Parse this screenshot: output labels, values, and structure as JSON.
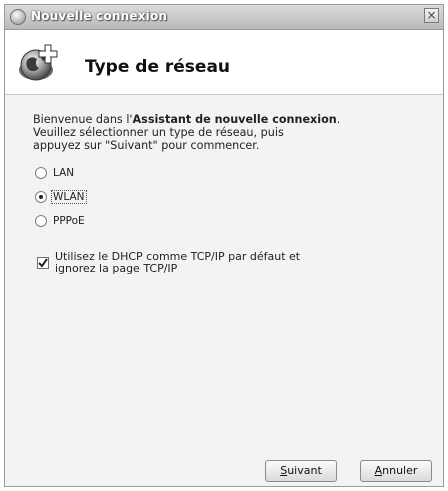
{
  "window": {
    "title": "Nouvelle connexion",
    "close_glyph": "×"
  },
  "header": {
    "icon": "network-globe-plus-icon",
    "title": "Type de réseau"
  },
  "intro": {
    "line1_prefix": "Bienvenue dans l'",
    "line1_bold": "Assistant de nouvelle connexion",
    "line1_suffix": ".",
    "line2": "Veuillez sélectionner un type de réseau, puis",
    "line3": "appuyez sur \"Suivant\" pour commencer."
  },
  "network_types": [
    {
      "label": "LAN",
      "selected": false
    },
    {
      "label": "WLAN",
      "selected": true
    },
    {
      "label": "PPPoE",
      "selected": false
    }
  ],
  "dhcp_option": {
    "checked": true,
    "line1": "Utilisez le DHCP comme TCP/IP par défaut et",
    "line2": "ignorez la page TCP/IP"
  },
  "buttons": {
    "next_mnemonic": "S",
    "next_rest": "uivant",
    "cancel_mnemonic": "A",
    "cancel_rest": "nnuler"
  },
  "colors": {
    "titlebar": "#c4c4c4",
    "background": "#f3f3f3",
    "header_bg": "#ffffff"
  }
}
